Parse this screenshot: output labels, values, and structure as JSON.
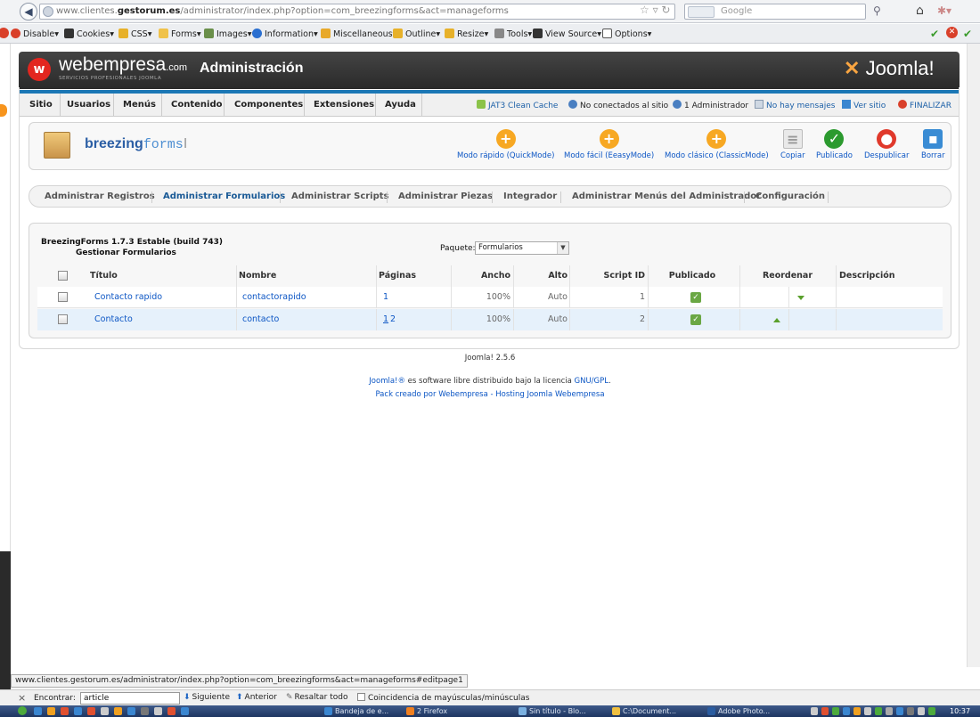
{
  "browser": {
    "url_prefix": "www.clientes.",
    "url_domain": "gestorum.es",
    "url_rest": "/administrator/index.php?option=com_breezingforms&act=manageforms",
    "search_placeholder": "Google"
  },
  "devbar": {
    "items": [
      "Disable▾",
      "Cookies▾",
      "CSS▾",
      "Forms▾",
      "Images▾",
      "Information▾",
      "Miscellaneous▾",
      "Outline▾",
      "Resize▾",
      "Tools▾",
      "View Source▾",
      "Options▾"
    ]
  },
  "header": {
    "logo_text": "webempresa",
    "logo_suffix": ".com",
    "logo_sub": "SERVICIOS PROFESIONALES JOOMLA",
    "title": "Administración",
    "joomla_logo": "Joomla!"
  },
  "menubar": {
    "items": [
      "Sitio",
      "Usuarios",
      "Menús",
      "Contenido",
      "Componentes",
      "Extensiones",
      "Ayuda"
    ],
    "status": {
      "clean_cache": "JAT3 Clean Cache",
      "not_connected": "No conectados al sitio",
      "admins": "1 Administrador",
      "messages": "No hay mensajes",
      "view_site": "Ver sitio",
      "logout": "FINALIZAR"
    }
  },
  "toolbar": {
    "brand_bold": "breezing",
    "brand_rest": "forms",
    "buttons": [
      "Modo rápido (QuickMode)",
      "Modo fácil (EeasyMode)",
      "Modo clásico (ClassicMode)",
      "Copiar",
      "Publicado",
      "Despublicar",
      "Borrar"
    ]
  },
  "submenu": {
    "items": [
      "Administrar Registros",
      "Administrar Formularios",
      "Administrar Scripts",
      "Administrar Piezas",
      "Integrador",
      "Administrar Menús del Administrador",
      "Configuración"
    ]
  },
  "panel": {
    "version": "BreezingForms 1.7.3 Estable (build 743)",
    "subtitle": "Gestionar Formularios",
    "package_label": "Paquete:",
    "package_value": "Formularios",
    "columns": [
      "Título",
      "Nombre",
      "Páginas",
      "Ancho",
      "Alto",
      "Script ID",
      "Publicado",
      "Reordenar",
      "Descripción"
    ],
    "rows": [
      {
        "title": "Contacto rapido",
        "name": "contactorapido",
        "page1": "1",
        "page2": "",
        "width": "100%",
        "height": "Auto",
        "script_id": "1",
        "description": ""
      },
      {
        "title": "Contacto",
        "name": "contacto",
        "page1": "1",
        "page2": "2",
        "width": "100%",
        "height": "Auto",
        "script_id": "2",
        "description": ""
      }
    ]
  },
  "footer": {
    "version": "Joomla! 2.5.6",
    "license_link": "Joomla!®",
    "license_text": " es software libre distribuido bajo la licencia ",
    "license_link2": "GNU/GPL",
    "license_end": ".",
    "pack": "Pack creado por Webempresa - Hosting Joomla Webempresa"
  },
  "status_preview": "www.clientes.gestorum.es/administrator/index.php?option=com_breezingforms&act=manageforms#editpage1",
  "findbar": {
    "close": "×",
    "label": "Encontrar:",
    "query": "article",
    "next": "Siguiente",
    "prev": "Anterior",
    "highlight": "Resaltar todo",
    "match_case": "Coincidencia de mayúsculas/minúsculas"
  },
  "taskbar": {
    "tasks": [
      "Bandeja de e...",
      "2 Firefox",
      "Sin título - Blo...",
      "C:\\Document...",
      "Adobe Photo..."
    ],
    "clock": "10:37"
  },
  "colors": {
    "link": "#0b55c4",
    "menubar_accent": "#1b77b5",
    "joomla_orange": "#f9a541",
    "header_bg": "#333333"
  }
}
